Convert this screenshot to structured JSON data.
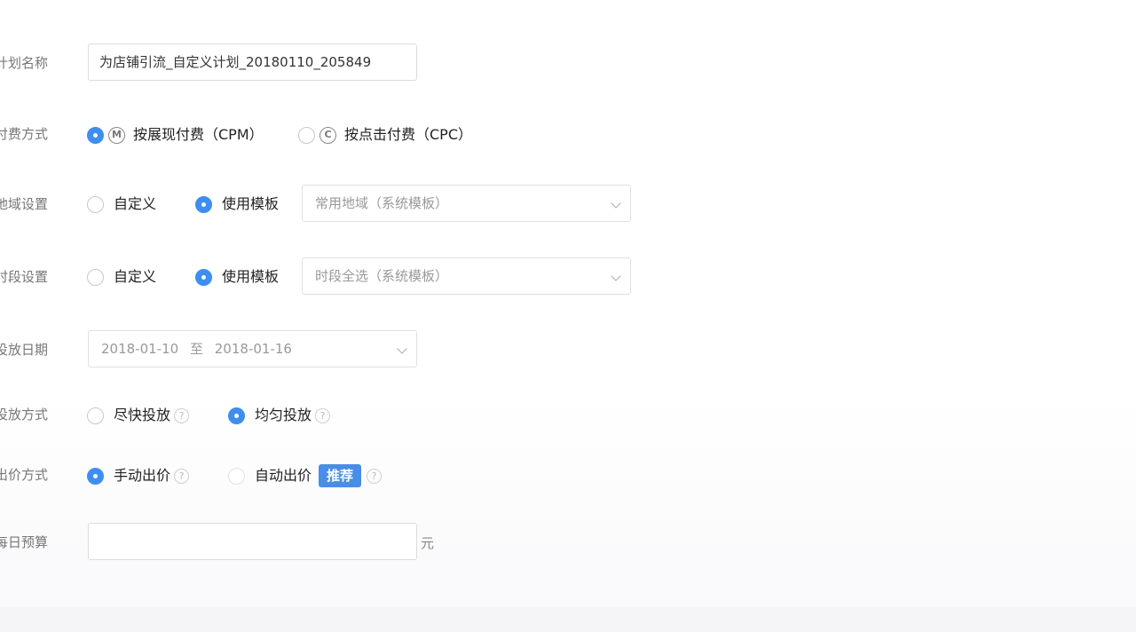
{
  "plan_name": {
    "label": "计划名称",
    "value": "为店铺引流_自定义计划_20180110_205849"
  },
  "billing": {
    "label": "付费方式",
    "options": [
      {
        "icon_letter": "M",
        "label": "按展现付费（CPM）",
        "selected": true
      },
      {
        "icon_letter": "C",
        "label": "按点击付费（CPC）",
        "selected": false
      }
    ]
  },
  "region": {
    "label": "地域设置",
    "options": [
      {
        "label": "自定义",
        "selected": false
      },
      {
        "label": "使用模板",
        "selected": true
      }
    ],
    "template_value": "常用地域（系统模板）"
  },
  "timeslot": {
    "label": "时段设置",
    "options": [
      {
        "label": "自定义",
        "selected": false
      },
      {
        "label": "使用模板",
        "selected": true
      }
    ],
    "template_value": "时段全选（系统模板）"
  },
  "dates": {
    "label": "投放日期",
    "start": "2018-01-10",
    "separator": "至",
    "end": "2018-01-16"
  },
  "delivery": {
    "label": "投放方式",
    "options": [
      {
        "label": "尽快投放",
        "selected": false
      },
      {
        "label": "均匀投放",
        "selected": true
      }
    ]
  },
  "bidding": {
    "label": "出价方式",
    "options": [
      {
        "label": "手动出价",
        "selected": true
      },
      {
        "label": "自动出价",
        "selected": false,
        "badge": "推荐"
      }
    ]
  },
  "budget": {
    "label": "每日预算",
    "value": "",
    "unit": "元"
  },
  "icons": {
    "help": "?",
    "help_icon_name": "help-circle-icon",
    "dropdown_icon_name": "chevron-down-icon"
  },
  "colors": {
    "accent": "#3e8ef0",
    "badge": "#4a8de8"
  }
}
